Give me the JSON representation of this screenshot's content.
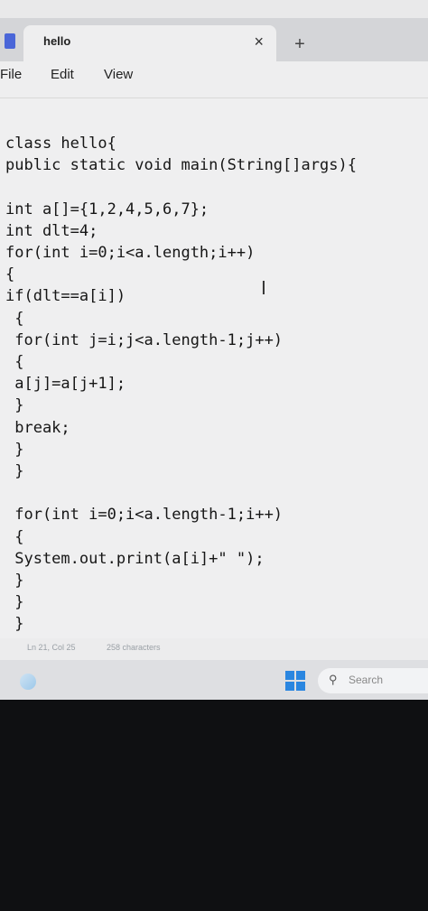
{
  "window": {
    "tab_title": "hello",
    "close_glyph": "×",
    "new_tab_glyph": "+"
  },
  "menu": {
    "items": [
      "File",
      "Edit",
      "View"
    ]
  },
  "editor": {
    "code": "class hello{\npublic static void main(String[]args){\n\nint a[]={1,2,4,5,6,7};\nint dlt=4;\nfor(int i=0;i<a.length;i++)\n{\nif(dlt==a[i])\n {\n for(int j=i;j<a.length-1;j++)\n {\n a[j]=a[j+1];\n }\n break;\n }\n }\n\n for(int i=0;i<a.length-1;i++)\n {\n System.out.print(a[i]+\" \");\n }\n }\n }"
  },
  "status": {
    "position": "Ln 21, Col 25",
    "characters": "258 characters"
  },
  "taskbar": {
    "search_label": "Search",
    "icons": [
      "edge-icon",
      "windows-start-icon",
      "search-icon"
    ]
  },
  "colors": {
    "accent": "#2a86e0",
    "app_icon": "#4a66d8"
  }
}
